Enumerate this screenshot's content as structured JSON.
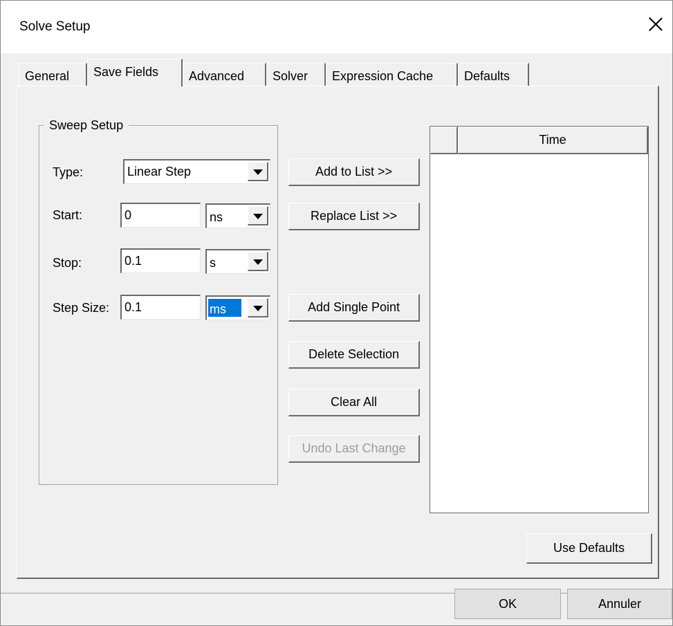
{
  "window": {
    "title": "Solve Setup"
  },
  "tabs": [
    {
      "label": "General"
    },
    {
      "label": "Save Fields"
    },
    {
      "label": "Advanced"
    },
    {
      "label": "Solver"
    },
    {
      "label": "Expression Cache"
    },
    {
      "label": "Defaults"
    }
  ],
  "active_tab": "Save Fields",
  "sweep": {
    "group_title": "Sweep Setup",
    "type_label": "Type:",
    "type_value": "Linear Step",
    "start_label": "Start:",
    "start_value": "0",
    "start_unit": "ns",
    "stop_label": "Stop:",
    "stop_value": "0.1",
    "stop_unit": "s",
    "step_label": "Step Size:",
    "step_value": "0.1",
    "step_unit": "ms"
  },
  "actions": {
    "add_to_list": "Add to List >>",
    "replace_list": "Replace List >>",
    "add_single_point": "Add Single Point",
    "delete_selection": "Delete Selection",
    "clear_all": "Clear All",
    "undo_last_change": "Undo Last Change"
  },
  "list": {
    "column_header": "Time",
    "rows": []
  },
  "use_defaults": "Use Defaults",
  "dialog": {
    "ok": "OK",
    "cancel": "Annuler"
  },
  "colors": {
    "selection": "#0078d7",
    "disabled_text": "#9c9c9c",
    "face": "#f0f0f0"
  }
}
